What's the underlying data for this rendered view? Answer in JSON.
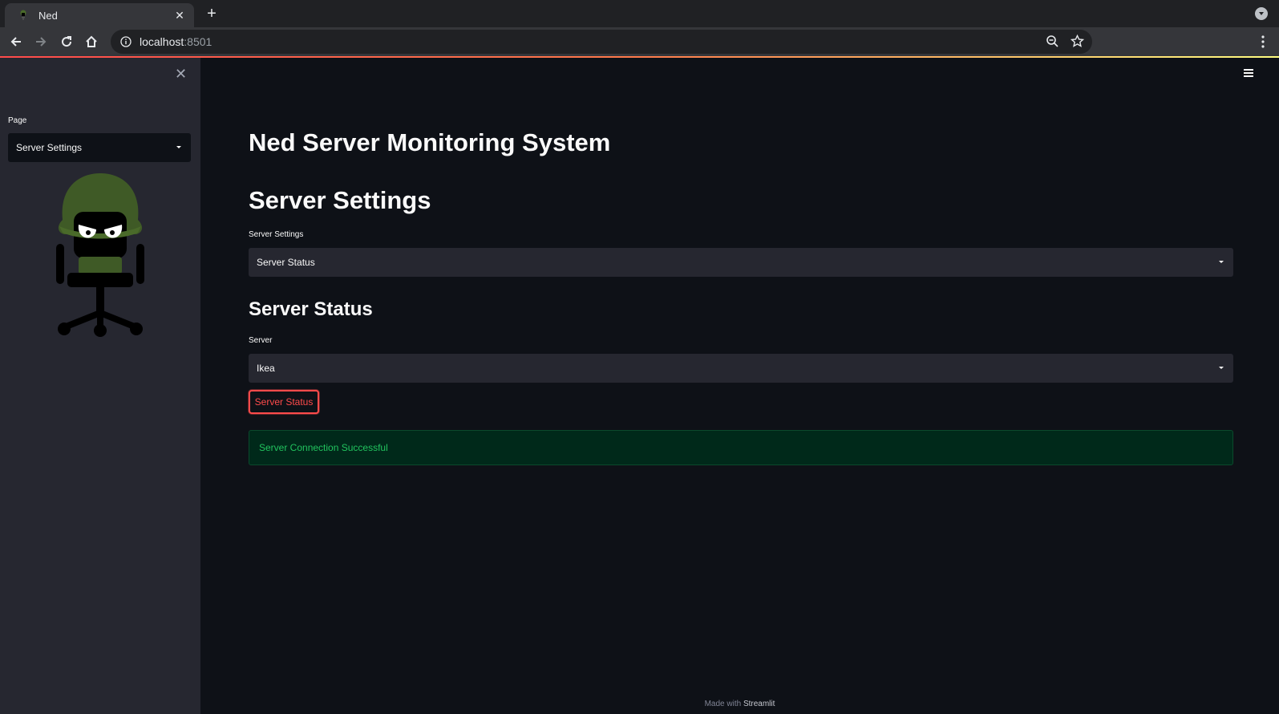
{
  "browser": {
    "tab_title": "Ned",
    "url_host": "localhost",
    "url_port": ":8501"
  },
  "sidebar": {
    "page_label": "Page",
    "page_select_value": "Server Settings"
  },
  "main": {
    "title": "Ned Server Monitoring System",
    "section_header": "Server Settings",
    "settings_label": "Server Settings",
    "settings_select_value": "Server Status",
    "subheader": "Server Status",
    "server_label": "Server",
    "server_select_value": "Ikea",
    "status_button_label": "Server Status",
    "success_message": "Server Connection Successful"
  },
  "footer": {
    "made_with": "Made with",
    "brand": "Streamlit"
  },
  "colors": {
    "accent": "#ff4b4b",
    "success_text": "#21c35e",
    "background": "#0e1117",
    "sidebar": "#262730"
  }
}
